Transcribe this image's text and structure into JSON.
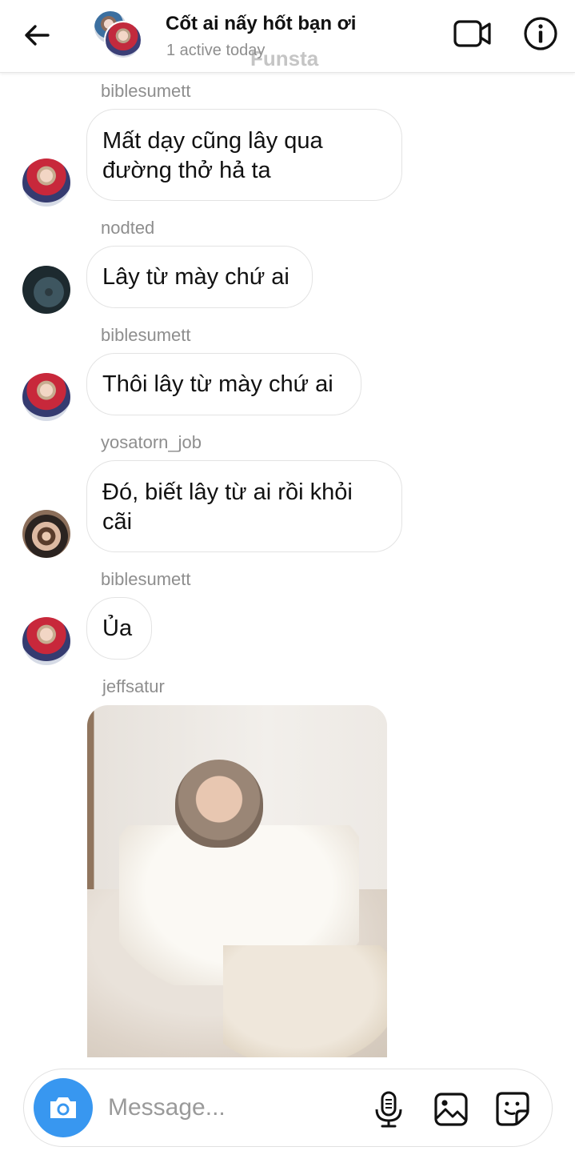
{
  "header": {
    "title": "Cốt ai nấy hốt bạn ơi",
    "status": "1 active today",
    "watermark": "Funsta",
    "back_icon": "arrow-left-icon",
    "video_icon": "video-camera-icon",
    "info_icon": "info-icon"
  },
  "messages": [
    {
      "sender": "biblesumett",
      "text": "Mất dạy cũng lây qua đường thở hả ta"
    },
    {
      "sender": "nodted",
      "text": "Lây từ mày chứ ai"
    },
    {
      "sender": "biblesumett",
      "text": "Thôi lây từ mày chứ ai"
    },
    {
      "sender": "yosatorn_job",
      "text": "Đó, biết lây từ ai rồi khỏi cãi"
    },
    {
      "sender": "biblesumett",
      "text": "Ủa"
    },
    {
      "sender": "jeffsatur",
      "type": "photo"
    }
  ],
  "composer": {
    "placeholder": "Message...",
    "camera_icon": "camera-icon",
    "mic_icon": "microphone-icon",
    "gallery_icon": "image-icon",
    "sticker_icon": "sticker-icon"
  },
  "colors": {
    "accent": "#3897f0",
    "secondary_text": "#8e8e8e",
    "bubble_border": "#e3e3e3"
  }
}
